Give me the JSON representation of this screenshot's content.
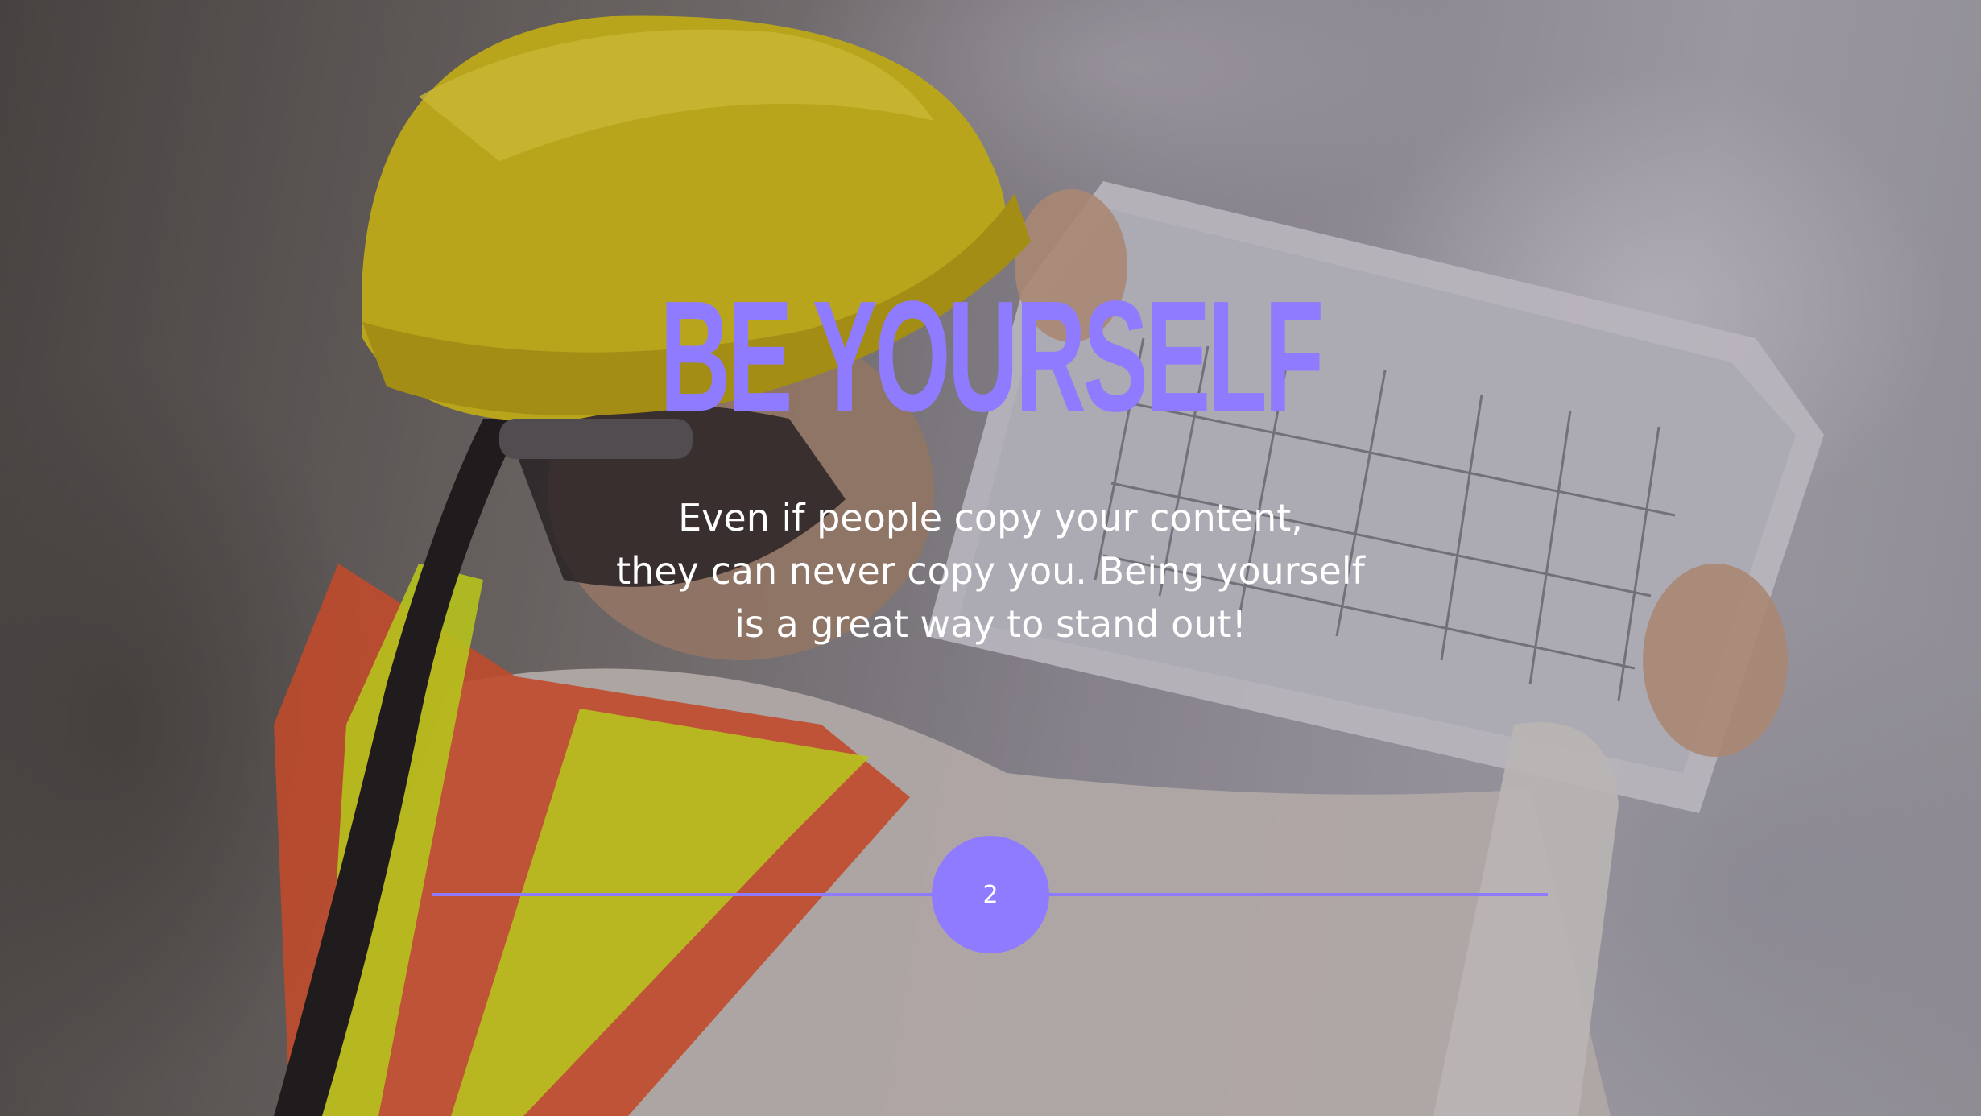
{
  "slide": {
    "title": "BE YOURSELF",
    "body_lines": [
      "Even if people copy your content,",
      "they can never copy you. Being yourself",
      "is a great way to stand out!"
    ],
    "page_number": "2"
  },
  "colors": {
    "accent": "#8f7bff",
    "body_text": "#ffffff"
  },
  "background": {
    "icon": "photo-worker-hardhat-blueprint"
  }
}
